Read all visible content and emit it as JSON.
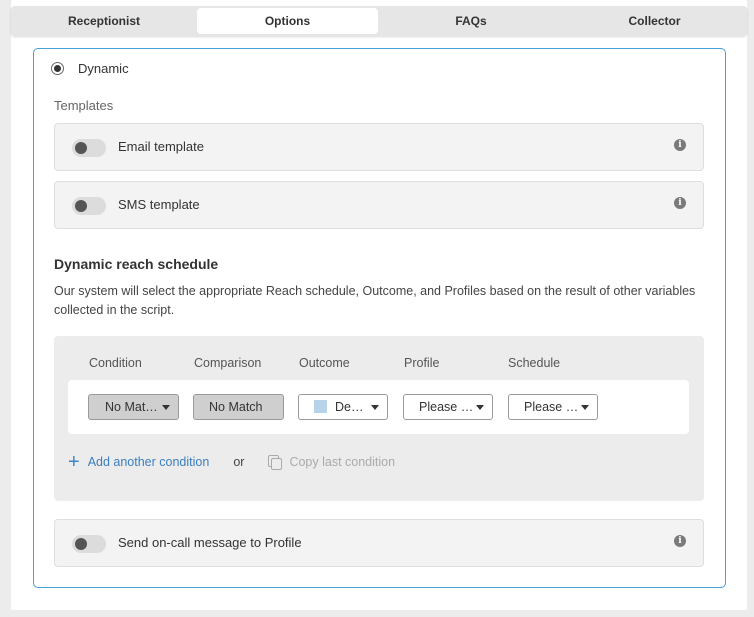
{
  "tabs": [
    {
      "label": "Receptionist",
      "active": false
    },
    {
      "label": "Options",
      "active": true
    },
    {
      "label": "FAQs",
      "active": false
    },
    {
      "label": "Collector",
      "active": false
    }
  ],
  "mode": {
    "label": "Dynamic",
    "selected": true
  },
  "templates": {
    "section_label": "Templates",
    "email": {
      "label": "Email template",
      "enabled": false
    },
    "sms": {
      "label": "SMS template",
      "enabled": false
    }
  },
  "schedule": {
    "heading": "Dynamic reach schedule",
    "description": "Our system will select the appropriate Reach schedule, Outcome, and Profiles based on the result of other variables collected in the script.",
    "columns": [
      "Condition",
      "Comparison",
      "Outcome",
      "Profile",
      "Schedule"
    ],
    "row": {
      "condition": "No Mat…",
      "comparison": "No Match",
      "outcome": "De…",
      "outcome_color": "#b6d3ea",
      "profile": "Please …",
      "schedule": "Please …"
    },
    "add_label": "Add another condition",
    "or_label": "or",
    "copy_label": "Copy last condition"
  },
  "oncall": {
    "label": "Send on-call message to Profile",
    "enabled": false
  },
  "colors": {
    "accent": "#4a9fd8",
    "link": "#3a7fc0"
  }
}
